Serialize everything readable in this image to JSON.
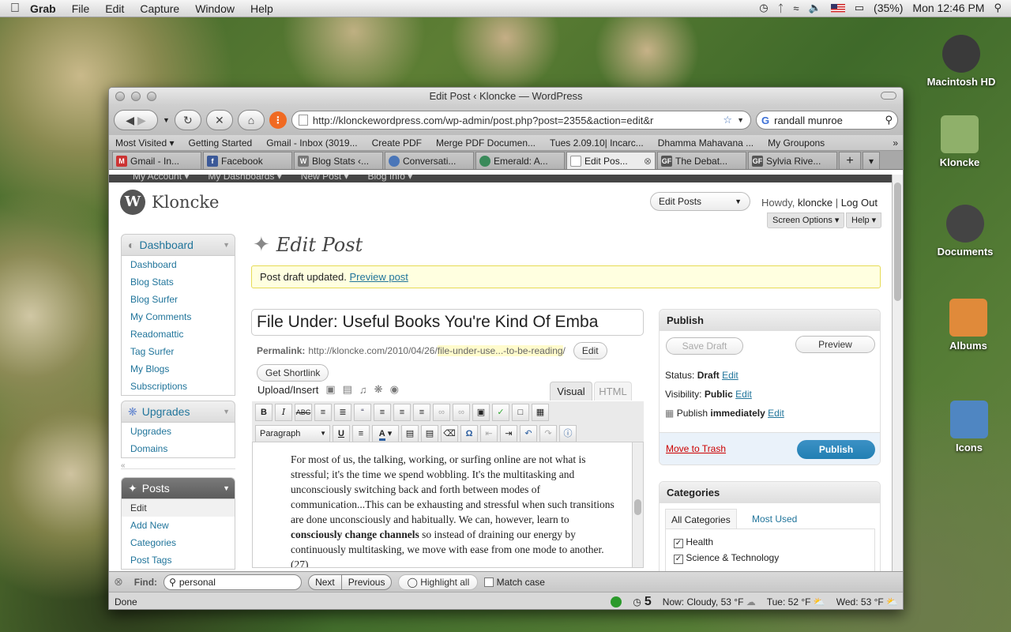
{
  "menubar": {
    "app": "Grab",
    "items": [
      "File",
      "Edit",
      "Capture",
      "Window",
      "Help"
    ],
    "battery": "(35%)",
    "clock": "Mon 12:46 PM"
  },
  "desktop": [
    {
      "label": "Macintosh HD",
      "icon": "hard-drive-icon",
      "color": "#3a3a3a"
    },
    {
      "label": "Kloncke",
      "icon": "folder-icon",
      "color": "#8fb06a"
    },
    {
      "label": "Documents",
      "icon": "folder-icon",
      "color": "#444"
    },
    {
      "label": "Albums",
      "icon": "folder-icon",
      "color": "#e08a3a"
    },
    {
      "label": "Icons",
      "icon": "folder-icon",
      "color": "#4f86c2"
    }
  ],
  "browser": {
    "title": "Edit Post ‹ Kloncke — WordPress",
    "url": "http://klonckewordpress.com/wp-admin/post.php?post=2355&action=edit&r",
    "search": "randall munroe",
    "bookmarks": [
      "Most Visited ▾",
      "Getting Started",
      "Gmail - Inbox (3019...",
      "Create PDF",
      "Merge PDF Documen...",
      "Tues 2.09.10| Incarc...",
      "Dhamma Mahavana ...",
      "My Groupons"
    ],
    "tabs": [
      {
        "label": "Gmail - In...",
        "icon": "gmail-icon",
        "color": "#c33"
      },
      {
        "label": "Facebook",
        "icon": "facebook-icon",
        "color": "#3b5998"
      },
      {
        "label": "Blog Stats ‹...",
        "icon": "wordpress-icon",
        "color": "#777"
      },
      {
        "label": "Conversati...",
        "icon": "globe-icon",
        "color": "#4a76b8"
      },
      {
        "label": "Emerald: A...",
        "icon": "emerald-icon",
        "color": "#3a8a5a"
      },
      {
        "label": "Edit Pos...",
        "icon": "page-icon",
        "color": "#999"
      },
      {
        "label": "The Debat...",
        "icon": "gf-icon",
        "color": "#555"
      },
      {
        "label": "Sylvia Rive...",
        "icon": "gf-icon",
        "color": "#555"
      }
    ]
  },
  "wp": {
    "adminbar": [
      "My Account ▾",
      "My Dashboards ▾",
      "New Post ▾",
      "Blog Info ▾"
    ],
    "blog_name": "Kloncke",
    "edit_posts": "Edit Posts",
    "howdy": "Howdy,",
    "user": "kloncke",
    "logout": "Log Out",
    "screen_options": "Screen Options ▾",
    "help": "Help ▾",
    "page_title": "Edit Post",
    "notice": "Post draft updated.",
    "notice_link": "Preview post",
    "post_title": "File Under: Useful Books You're Kind Of Emba",
    "permalink_label": "Permalink:",
    "permalink_base": "http://kloncke.com/2010/04/26/",
    "permalink_slug": "file-under-use...-to-be-reading",
    "permalink_end": "/",
    "edit_btn": "Edit",
    "shortlink_btn": "Get Shortlink",
    "upload": "Upload/Insert",
    "tab_visual": "Visual",
    "tab_html": "HTML",
    "format": "Paragraph",
    "body_1": "For most of us, the talking, working, or surfing online are not what is stressful; it's the time we spend wobbling. It's the multitasking and unconsciously switching back and forth between modes of communication...This can be exhausting and stressful when such transitions are done unconsciously and habitually. We can, however, learn to ",
    "body_bold": "consciously change channels",
    "body_2": " so instead of draining our energy by continuously multitasking, we move with ease from one mode to another. (27)",
    "sidebar": {
      "dashboard_head": "Dashboard",
      "dashboard_items": [
        "Dashboard",
        "Blog Stats",
        "Blog Surfer",
        "My Comments",
        "Readomattic",
        "Tag Surfer",
        "My Blogs",
        "Subscriptions"
      ],
      "upgrades_head": "Upgrades",
      "upgrades_items": [
        "Upgrades",
        "Domains"
      ],
      "posts_head": "Posts",
      "posts_items": [
        "Edit",
        "Add New",
        "Categories",
        "Post Tags"
      ]
    },
    "publish": {
      "head": "Publish",
      "save_draft": "Save Draft",
      "preview": "Preview",
      "status_label": "Status:",
      "status": "Draft",
      "visibility_label": "Visibility:",
      "visibility": "Public",
      "publish_label": "Publish",
      "publish_when": "immediately",
      "edit": "Edit",
      "trash": "Move to Trash",
      "publish_btn": "Publish"
    },
    "categories": {
      "head": "Categories",
      "tab_all": "All Categories",
      "tab_used": "Most Used",
      "items": [
        "Health",
        "Science & Technology"
      ]
    }
  },
  "findbar": {
    "label": "Find:",
    "query": "personal",
    "next": "Next",
    "previous": "Previous",
    "highlight": "Highlight all",
    "match_case": "Match case"
  },
  "statusbar": {
    "left": "Done",
    "count": "5",
    "now": "Now: Cloudy, 53 °F",
    "tue": "Tue: 52 °F",
    "wed": "Wed: 53 °F"
  }
}
